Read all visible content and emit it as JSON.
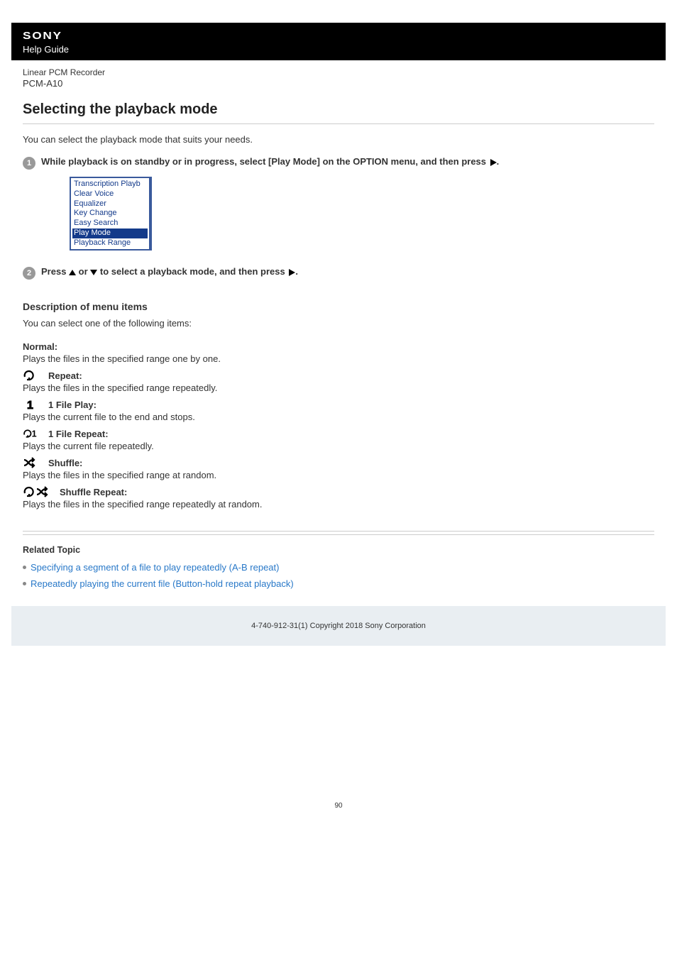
{
  "header": {
    "brand": "SONY",
    "guide": "Help Guide"
  },
  "product": {
    "line": "Linear PCM Recorder",
    "model": "PCM-A10"
  },
  "page": {
    "title": "Selecting the playback mode",
    "intro": "You can select the playback mode that suits your needs."
  },
  "steps": [
    {
      "num": "1",
      "text_before": "While playback is on standby or in progress, select [Play Mode] on the OPTION menu, and then press",
      "text_after": "."
    },
    {
      "num": "2",
      "text_before": "Press ",
      "mid": " or ",
      "mid2": " to select a playback mode, and then press",
      "text_after": "."
    }
  ],
  "device_menu": {
    "items": [
      "Transcription Playb",
      "Clear Voice",
      "Equalizer",
      "Key Change",
      "Easy Search",
      "Play Mode",
      "Playback Range"
    ],
    "selected_index": 5
  },
  "menu_section": {
    "heading": "Description of menu items",
    "desc": "You can select one of the following items:"
  },
  "items": [
    {
      "label": "Normal:",
      "desc": "Plays the files in the specified range one by one.",
      "icon": null
    },
    {
      "label": "Repeat:",
      "desc": "Plays the files in the specified range repeatedly.",
      "icon": "repeat"
    },
    {
      "label": "1 File Play:",
      "desc": "Plays the current file to the end and stops.",
      "icon": "one"
    },
    {
      "label": "1 File Repeat:",
      "desc": "Plays the current file repeatedly.",
      "icon": "repeat-one"
    },
    {
      "label": "Shuffle:",
      "desc": "Plays the files in the specified range at random.",
      "icon": "shuffle"
    },
    {
      "label": "Shuffle Repeat:",
      "desc": "Plays the files in the specified range repeatedly at random.",
      "icon": "repeat-shuffle"
    }
  ],
  "related": {
    "heading": "Related Topic",
    "links": [
      "Specifying a segment of a file to play repeatedly (A-B repeat)",
      "Repeatedly playing the current file (Button-hold repeat playback)"
    ]
  },
  "footer": {
    "copyright": "4-740-912-31(1) Copyright 2018 Sony Corporation"
  },
  "page_number": "90"
}
